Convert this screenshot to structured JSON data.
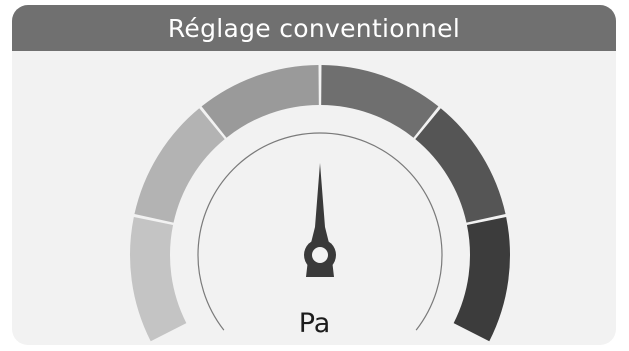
{
  "widget": {
    "title": "Réglage conventionnel",
    "unit": "Pa"
  },
  "gauge": {
    "segment_count": 6,
    "needle_value_fraction": 0.5,
    "colors": {
      "header": "#707070",
      "card": "#f2f2f2",
      "needle": "#3a3a3a",
      "segments": [
        "#c4c4c4",
        "#b3b3b3",
        "#9a9a9a",
        "#6f6f6f",
        "#555555",
        "#3c3c3c"
      ],
      "inner_ring": "#7a7a7a"
    }
  }
}
